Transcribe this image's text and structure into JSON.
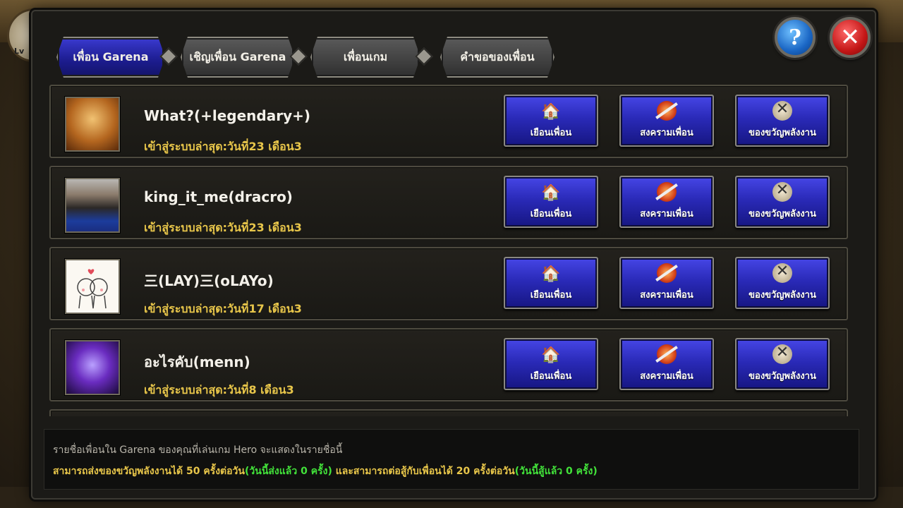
{
  "background": {
    "level_label": "Lv"
  },
  "tabs": [
    {
      "label": "เพื่อน Garena",
      "active": true
    },
    {
      "label": "เชิญเพื่อน Garena",
      "active": false
    },
    {
      "label": "เพื่อนเกม",
      "active": false
    },
    {
      "label": "คำขอของเพื่อน",
      "active": false
    }
  ],
  "buttons": {
    "help": "?",
    "close": "✕"
  },
  "actions": {
    "visit": "เยือนเพื่อน",
    "war": "สงครามเพื่อน",
    "gift": "ของขวัญพลังงาน"
  },
  "friends": [
    {
      "name": "What?(+legendary+)",
      "last_login": "เข้าสู่ระบบล่าสุด:วันที่23 เดือน3",
      "avatar": "warrior-portrait"
    },
    {
      "name": "king_it_me(dracro)",
      "last_login": "เข้าสู่ระบบล่าสุด:วันที่23 เดือน3",
      "avatar": "photo-portrait"
    },
    {
      "name": "三(LAY)三(oLAYo)",
      "last_login": "เข้าสู่ระบบล่าสุด:วันที่17 เดือน3",
      "avatar": "cartoon-couple"
    },
    {
      "name": "อะไรคับ(menn)",
      "last_login": "เข้าสู่ระบบล่าสุด:วันที่8 เดือน3",
      "avatar": "purple-monster"
    }
  ],
  "footer": {
    "note": "รายชื่อเพื่อนใน Garena ของคุณที่เล่นเกม Hero จะแสดงในรายชื่อนี้",
    "limit_part1": "สามารถส่งของขวัญพลังงานได้ 50 ครั้งต่อวัน",
    "limit_part2": "(วันนี้ส่งแล้ว 0 ครั้ง)",
    "limit_part3": " และสามารถต่อสู้กับเพื่อนได้ 20 ครั้งต่อวัน",
    "limit_part4": "(วันนี้สู้แล้ว 0 ครั้ง)"
  },
  "colors": {
    "accent_blue": "#2a2ab8",
    "gold_text": "#e8c64a",
    "green_text": "#42e23a"
  }
}
